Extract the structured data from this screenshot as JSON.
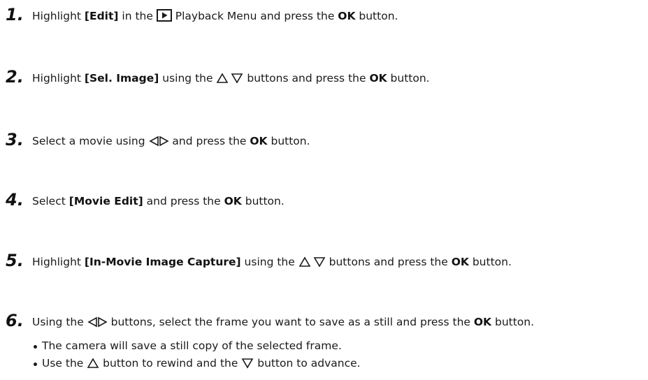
{
  "steps": [
    {
      "num": "1.",
      "parts": {
        "a": "Highlight ",
        "b": "[Edit]",
        "c": " in the ",
        "d": " Playback Menu and press the ",
        "e": "OK",
        "f": " button."
      },
      "icons": [
        "playback-menu-icon"
      ]
    },
    {
      "num": "2.",
      "parts": {
        "a": "Highlight ",
        "b": "[Sel. Image]",
        "c": " using the ",
        "d": " buttons and press the ",
        "e": "OK",
        "f": " button."
      },
      "icons": [
        "up-triangle-icon",
        "down-triangle-icon"
      ]
    },
    {
      "num": "3.",
      "parts": {
        "a": "Select a movie using ",
        "b": " and press the ",
        "c": "OK",
        "d": " button."
      },
      "icons": [
        "left-triangle-icon",
        "right-triangle-icon"
      ]
    },
    {
      "num": "4.",
      "parts": {
        "a": "Select ",
        "b": "[Movie Edit]",
        "c": " and press the ",
        "d": "OK",
        "e": " button."
      }
    },
    {
      "num": "5.",
      "parts": {
        "a": "Highlight ",
        "b": "[In-Movie Image Capture]",
        "c": " using the ",
        "d": " buttons and press the ",
        "e": "OK",
        "f": " button."
      },
      "icons": [
        "up-triangle-icon",
        "down-triangle-icon"
      ]
    },
    {
      "num": "6.",
      "parts": {
        "a": "Using the ",
        "b": " buttons, select the frame you want to save as a still and press the ",
        "c": "OK",
        "d": " button."
      },
      "icons": [
        "left-triangle-icon",
        "right-triangle-icon"
      ]
    }
  ],
  "bullets": [
    {
      "text": "The camera will save a still copy of the selected frame."
    },
    {
      "a": "Use the ",
      "b": " button to rewind and the ",
      "c": " button to advance.",
      "icons": [
        "up-triangle-icon",
        "down-triangle-icon"
      ]
    }
  ],
  "colors": {
    "text": "#1a1a1a",
    "background": "#ffffff"
  }
}
